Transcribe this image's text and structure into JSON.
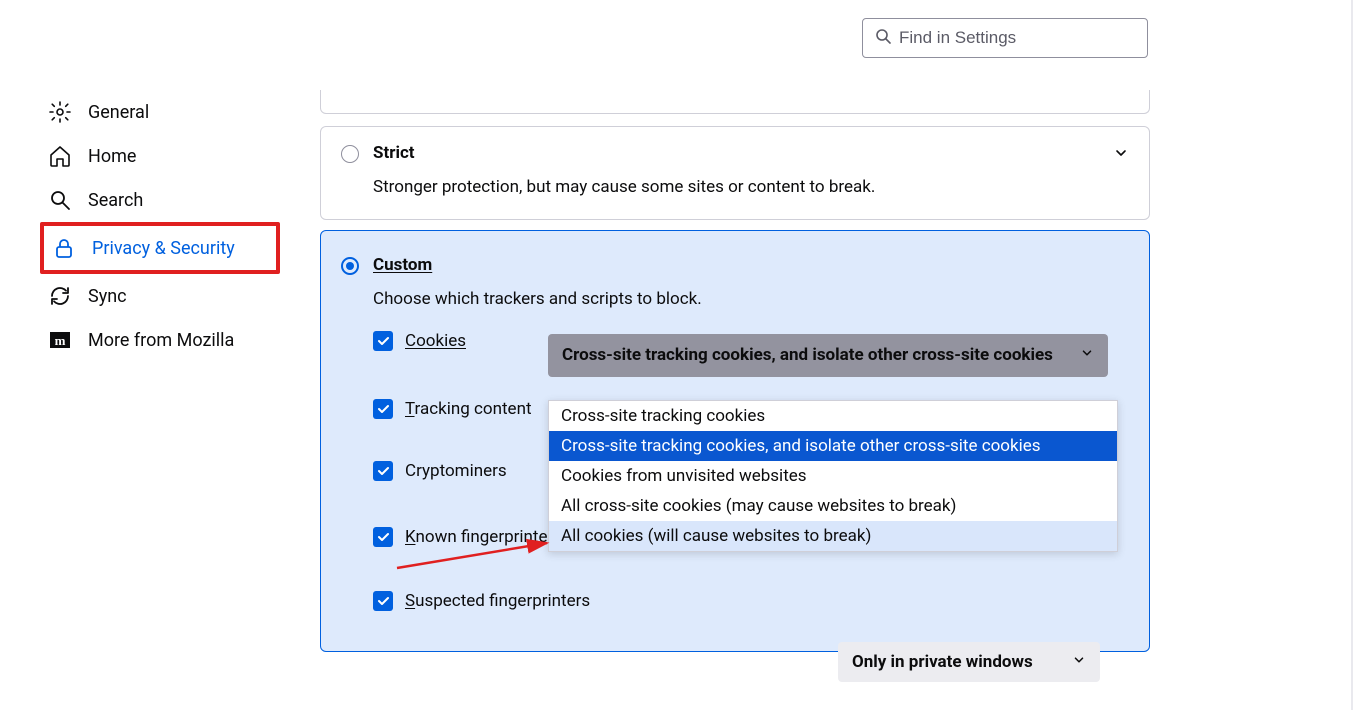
{
  "search": {
    "placeholder": "Find in Settings"
  },
  "sidebar": {
    "items": [
      {
        "label": "General"
      },
      {
        "label": "Home"
      },
      {
        "label": "Search"
      },
      {
        "label": "Privacy & Security"
      },
      {
        "label": "Sync"
      },
      {
        "label": "More from Mozilla"
      }
    ]
  },
  "strict": {
    "title": "Strict",
    "desc": "Stronger protection, but may cause some sites or content to break."
  },
  "custom": {
    "title": "Custom",
    "desc": "Choose which trackers and scripts to block.",
    "checks": {
      "cookies": "Cookies",
      "tracking": "Tracking content",
      "crypto": "Cryptominers",
      "known": "Known fingerprinters",
      "susp": "Suspected fingerprinters"
    },
    "cookiesSelected": "Cross-site tracking cookies, and isolate other cross-site cookies",
    "cookiesOptions": [
      "Cross-site tracking cookies",
      "Cross-site tracking cookies, and isolate other cross-site cookies",
      "Cookies from unvisited websites",
      "All cross-site cookies (may cause websites to break)",
      "All cookies (will cause websites to break)"
    ],
    "suspSelected": "Only in private windows"
  }
}
